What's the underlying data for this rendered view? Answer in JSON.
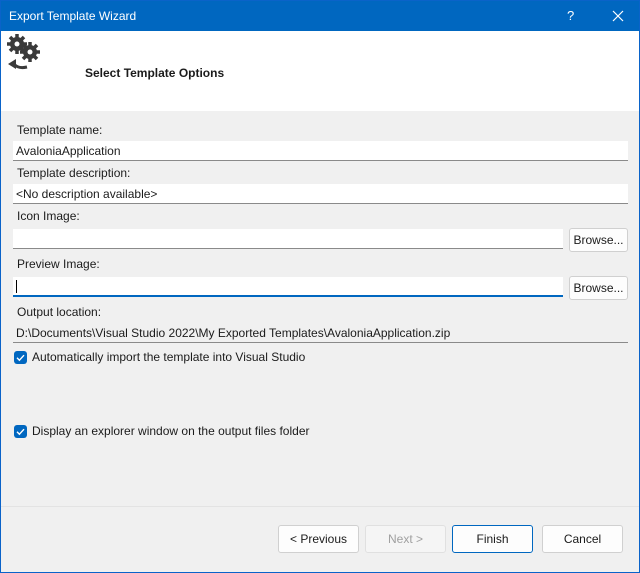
{
  "window": {
    "title": "Export Template Wizard",
    "help": "?"
  },
  "header": {
    "title": "Select Template Options",
    "icon": "gears-export-icon"
  },
  "fields": {
    "template_name": {
      "label": "Template name:",
      "value": "AvaloniaApplication"
    },
    "template_description": {
      "label": "Template description:",
      "value": "<No description available>"
    },
    "icon_image": {
      "label": "Icon Image:",
      "value": "",
      "browse": "Browse..."
    },
    "preview_image": {
      "label": "Preview Image:",
      "value": "",
      "browse": "Browse..."
    },
    "output_location": {
      "label": "Output location:",
      "value": "D:\\Documents\\Visual Studio 2022\\My Exported Templates\\AvaloniaApplication.zip"
    }
  },
  "options": {
    "auto_import": {
      "label": "Automatically import the template into Visual Studio",
      "checked": true
    },
    "explorer_window": {
      "label": "Display an explorer window on the output files folder",
      "checked": true
    }
  },
  "buttons": {
    "previous": "< Previous",
    "next": "Next >",
    "finish": "Finish",
    "cancel": "Cancel"
  },
  "colors": {
    "accent": "#0067c0"
  }
}
